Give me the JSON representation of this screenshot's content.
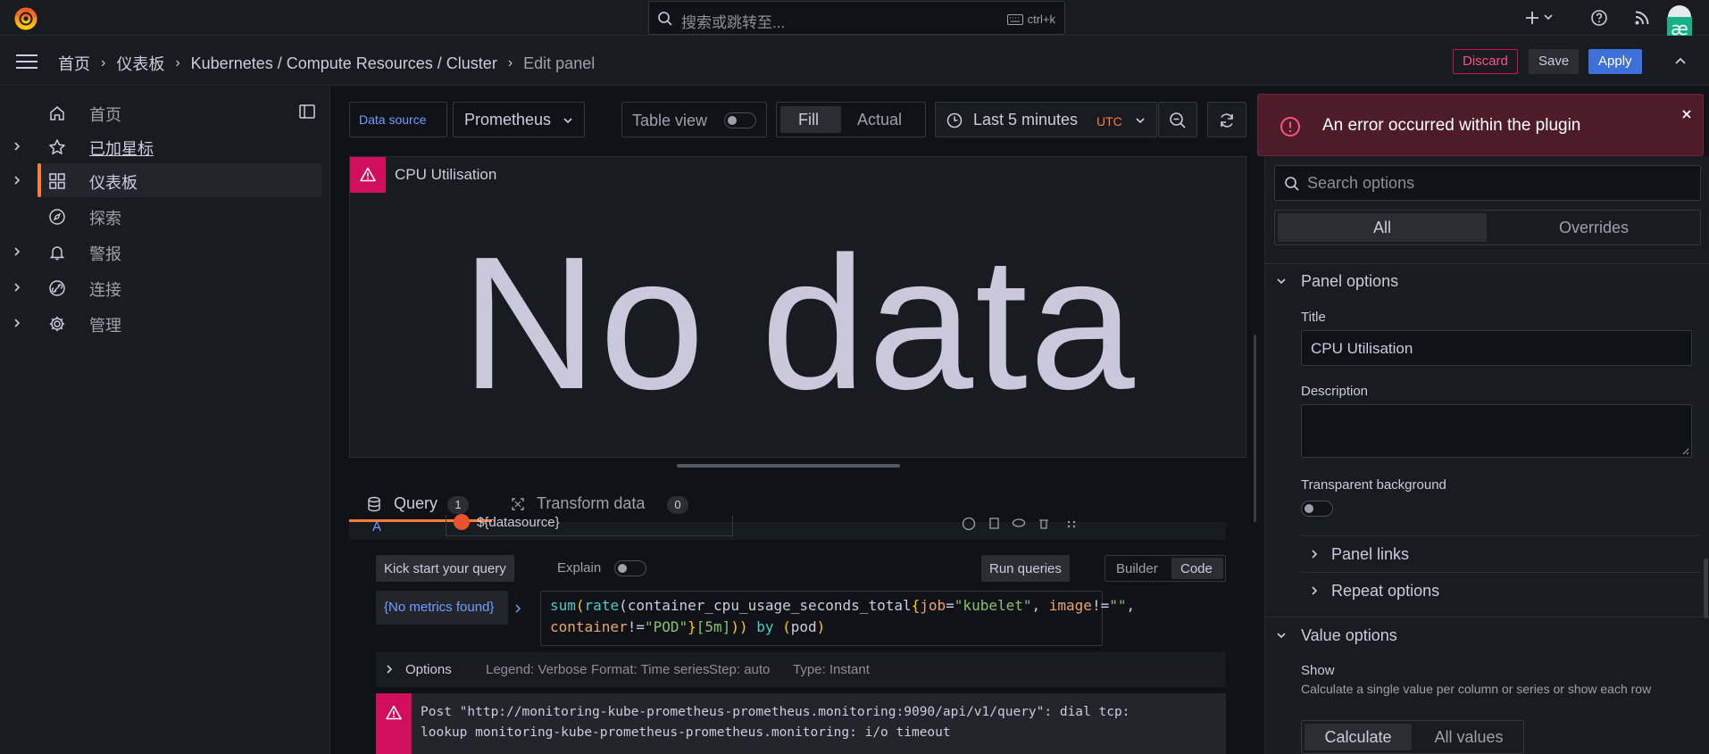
{
  "app": {
    "accent": "#3d71d9",
    "error": "#d10e5c"
  },
  "topbar": {
    "search_placeholder": "搜索或跳转至...",
    "search_shortcut": "ctrl+k",
    "icons": [
      "plus-icon",
      "chevron-down-icon",
      "help-icon",
      "rss-icon",
      "avatar"
    ]
  },
  "navbar": {
    "breadcrumbs": [
      "首页",
      "仪表板",
      "Kubernetes / Compute Resources / Cluster",
      "Edit panel"
    ],
    "discard_label": "Discard",
    "save_label": "Save",
    "apply_label": "Apply"
  },
  "sidebar": {
    "items": [
      {
        "label": "首页",
        "icon": "home-icon",
        "expandable": false
      },
      {
        "label": "已加星标",
        "icon": "star-icon",
        "expandable": true
      },
      {
        "label": "仪表板",
        "icon": "apps-icon",
        "expandable": true,
        "active": true
      },
      {
        "label": "探索",
        "icon": "compass-icon",
        "expandable": false
      },
      {
        "label": "警报",
        "icon": "bell-icon",
        "expandable": true
      },
      {
        "label": "连接",
        "icon": "link-icon",
        "expandable": true
      },
      {
        "label": "管理",
        "icon": "cog-icon",
        "expandable": true
      }
    ]
  },
  "toolbar": {
    "datasource_label": "Data source",
    "datasource_value": "Prometheus",
    "table_view_label": "Table view",
    "fill_label": "Fill",
    "actual_label": "Actual",
    "time_range": "Last 5 minutes",
    "timezone": "UTC"
  },
  "panel": {
    "title": "CPU Utilisation",
    "no_data": "No data"
  },
  "query_tabs": {
    "query_label": "Query",
    "query_count": "1",
    "transform_label": "Transform data",
    "transform_count": "0"
  },
  "editor": {
    "query_ref": "A",
    "datasource_var": "${datasource}",
    "kick_start_label": "Kick start your query",
    "explain_label": "Explain",
    "run_queries_label": "Run queries",
    "builder_label": "Builder",
    "code_label": "Code",
    "metrics_label": "{No metrics found}",
    "query_line1_parts": [
      "sum",
      "(",
      "rate",
      "(",
      "container_cpu_usage_seconds_total",
      "{",
      "job",
      "=",
      "\"kubelet\"",
      ", ",
      "image",
      "!=",
      "\"\"",
      ","
    ],
    "query_line2_parts": [
      "container",
      "!=",
      "\"POD\"",
      "}",
      "[5m]",
      "))",
      " by ",
      "(",
      "pod",
      ")"
    ],
    "options_label": "Options",
    "legend_info": "Legend: Verbose",
    "format_info": "Format: Time series",
    "step_info": "Step: auto",
    "type_info": "Type: Instant",
    "error_line1": "Post \"http://monitoring-kube-prometheus-prometheus.monitoring:9090/api/v1/query\": dial tcp:",
    "error_line2": "lookup monitoring-kube-prometheus-prometheus.monitoring: i/o timeout"
  },
  "toast": {
    "message": "An error occurred within the plugin"
  },
  "options_pane": {
    "search_placeholder": "Search options",
    "tab_all": "All",
    "tab_overrides": "Overrides",
    "panel_options_label": "Panel options",
    "title_label": "Title",
    "title_value": "CPU Utilisation",
    "description_label": "Description",
    "transparent_label": "Transparent background",
    "panel_links_label": "Panel links",
    "repeat_options_label": "Repeat options",
    "value_options_label": "Value options",
    "show_label": "Show",
    "show_desc": "Calculate a single value per column or series or show each row",
    "calculate_label": "Calculate",
    "all_values_label": "All values"
  }
}
